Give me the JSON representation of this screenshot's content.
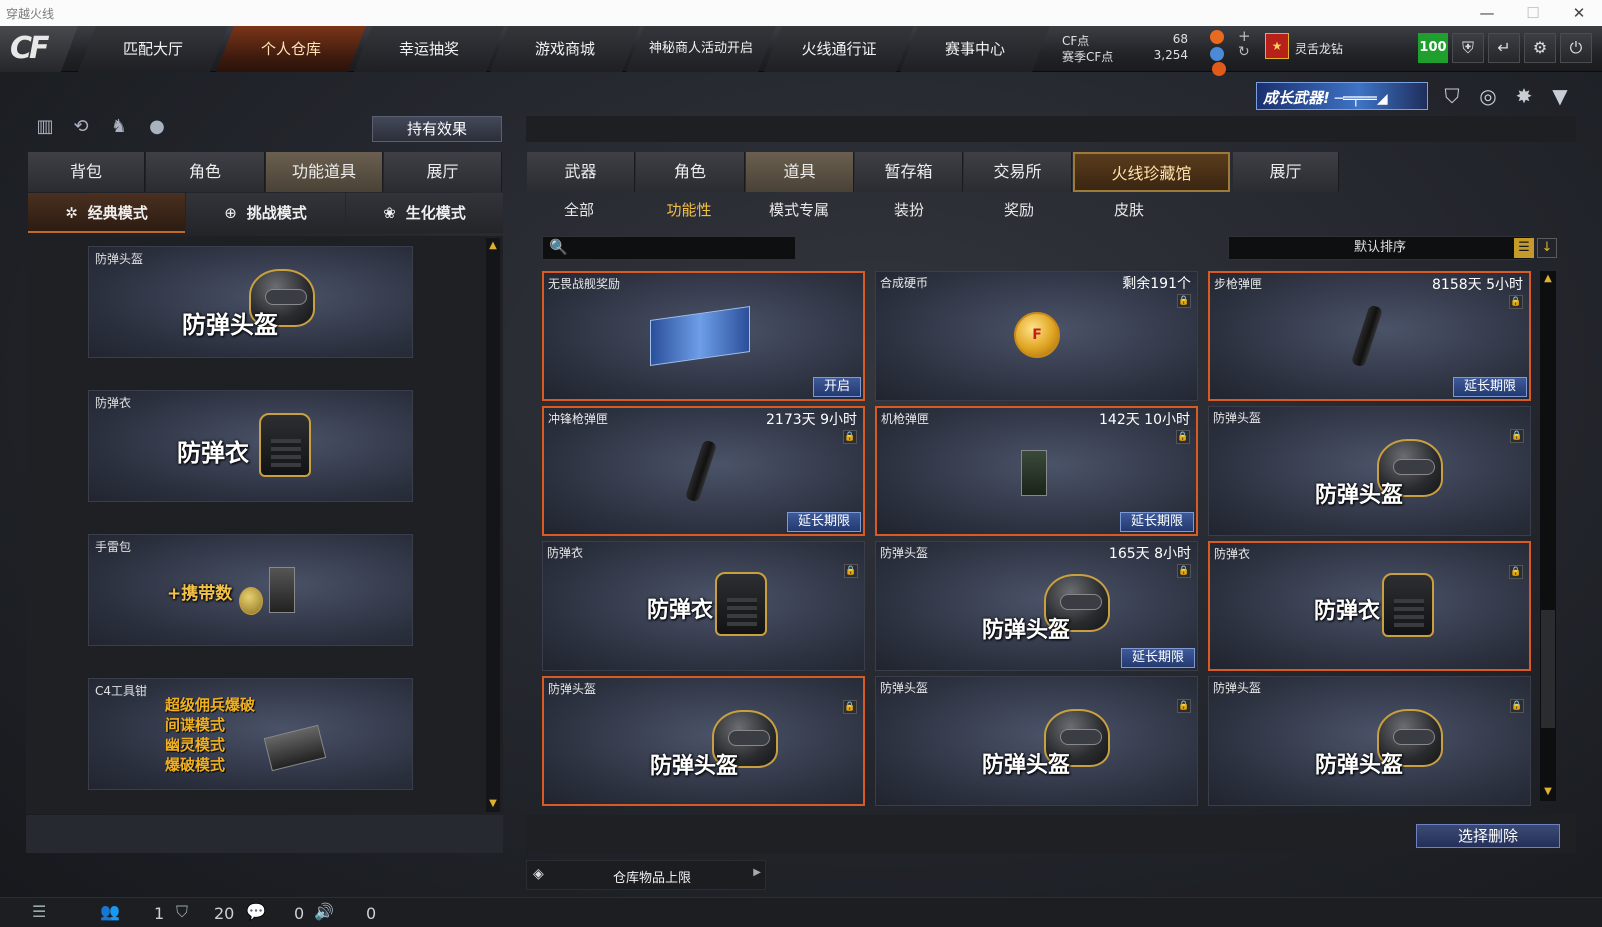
{
  "window": {
    "title": "穿越火线",
    "controls": [
      "—",
      "☐",
      "✕"
    ]
  },
  "topnav": {
    "logo": "CF",
    "tabs": [
      "匹配大厅",
      "个人仓库",
      "幸运抽奖",
      "游戏商城",
      "神秘商人活动开启",
      "火线通行证",
      "赛事中心"
    ],
    "active_index": 1
  },
  "currency": {
    "cf_label": "CF点",
    "cf_value": "68",
    "season_label": "赛季CF点",
    "season_value": "3,254"
  },
  "user": {
    "title": "灵舌龙钻",
    "level_badge": "100"
  },
  "top_icons": [
    "shield-icon",
    "return-icon",
    "gear-icon",
    "power-icon"
  ],
  "banner": {
    "text": "成长武器!"
  },
  "left": {
    "effect_button": "持有效果",
    "tabs": [
      "背包",
      "角色",
      "功能道具",
      "展厅"
    ],
    "active_tab": 2,
    "modes": [
      "经典模式",
      "挑战模式",
      "生化模式"
    ],
    "active_mode": 0,
    "items": [
      {
        "caption": "防弹头盔",
        "label": "防弹头盔",
        "icon": "helmet-icon"
      },
      {
        "caption": "防弹衣",
        "label": "防弹衣",
        "icon": "vest-icon"
      },
      {
        "caption": "手雷包",
        "label": "+携带数",
        "icon": "grenade-pack-icon"
      },
      {
        "caption": "C4工具钳",
        "lines": [
          "超级佣兵爆破",
          "间谍模式",
          "幽灵模式",
          "爆破模式"
        ],
        "icon": "c4-toolkit-icon"
      }
    ]
  },
  "right": {
    "tabs": [
      "武器",
      "角色",
      "道具",
      "暂存箱",
      "交易所",
      "火线珍藏馆",
      "展厅"
    ],
    "active_tab": 2,
    "gold_tab": 5,
    "subtabs": [
      "全部",
      "功能性",
      "模式专属",
      "装扮",
      "奖励",
      "皮肤"
    ],
    "active_subtab": 1,
    "search": {
      "placeholder": ""
    },
    "sort": {
      "label": "默认排序"
    },
    "items": [
      {
        "caption": "无畏战舰奖励",
        "time": "",
        "action": "开启",
        "icon": "book-icon",
        "label": "",
        "highlight": true,
        "lock": false
      },
      {
        "caption": "合成硬币",
        "time": "剩余191个",
        "action": "",
        "icon": "coin-icon",
        "label": "",
        "highlight": false,
        "lock": true
      },
      {
        "caption": "步枪弹匣",
        "time": "8158天 5小时",
        "action": "延长期限",
        "icon": "magazine-icon",
        "label": "",
        "highlight": true,
        "lock": true
      },
      {
        "caption": "冲锋枪弹匣",
        "time": "2173天 9小时",
        "action": "延长期限",
        "icon": "magazine-icon",
        "label": "",
        "highlight": true,
        "lock": true
      },
      {
        "caption": "机枪弹匣",
        "time": "142天 10小时",
        "action": "延长期限",
        "icon": "ammo-box-icon",
        "label": "",
        "highlight": true,
        "lock": true
      },
      {
        "caption": "防弹头盔",
        "time": "",
        "action": "",
        "icon": "helmet-icon",
        "label": "防弹头盔",
        "highlight": false,
        "lock": true
      },
      {
        "caption": "防弹衣",
        "time": "",
        "action": "",
        "icon": "vest-icon",
        "label": "防弹衣",
        "highlight": false,
        "lock": true
      },
      {
        "caption": "防弹头盔",
        "time": "165天 8小时",
        "action": "延长期限",
        "icon": "helmet-icon",
        "label": "防弹头盔",
        "highlight": false,
        "lock": true
      },
      {
        "caption": "防弹衣",
        "time": "",
        "action": "",
        "icon": "vest-icon",
        "label": "防弹衣",
        "highlight": true,
        "lock": true
      },
      {
        "caption": "防弹头盔",
        "time": "",
        "action": "",
        "icon": "helmet-icon",
        "label": "防弹头盔",
        "highlight": true,
        "lock": true
      },
      {
        "caption": "防弹头盔",
        "time": "",
        "action": "",
        "icon": "helmet-icon",
        "label": "防弹头盔",
        "highlight": false,
        "lock": true
      },
      {
        "caption": "防弹头盔",
        "time": "",
        "action": "",
        "icon": "helmet-icon",
        "label": "防弹头盔",
        "highlight": false,
        "lock": true
      }
    ],
    "delete_button": "选择删除",
    "capacity_label": "仓库物品上限"
  },
  "statusbar": {
    "friends": "1",
    "clan": "20",
    "messages": "0",
    "voice": "0"
  }
}
